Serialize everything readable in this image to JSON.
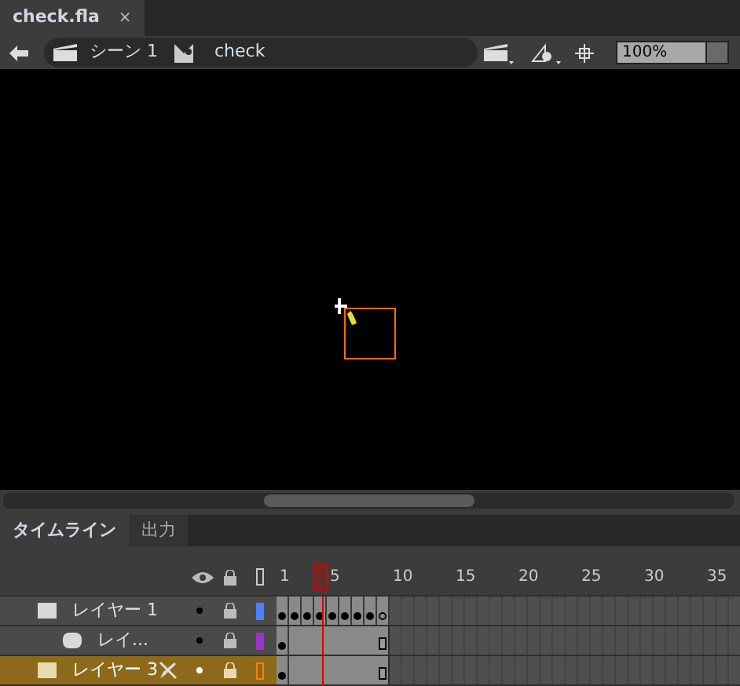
{
  "document_tab": {
    "title": "check.fla",
    "close": "×"
  },
  "edit_bar": {
    "scene": "シーン 1",
    "symbol": "check",
    "zoom": "100%"
  },
  "panel_tabs": [
    {
      "label": "タイムライン",
      "selected": true
    },
    {
      "label": "出力",
      "selected": false
    }
  ],
  "ruler": {
    "labels": [
      "1",
      "5",
      "10",
      "15",
      "20",
      "25",
      "30",
      "35"
    ],
    "playhead": {
      "level": 0.097
    }
  },
  "layers": [
    {
      "name": "レイヤー 1",
      "selected": false,
      "color": "#4f7fff",
      "outline": false,
      "frames": [
        {
          "kind": "key"
        },
        {
          "kind": "key"
        },
        {
          "kind": "key"
        },
        {
          "kind": "key"
        },
        {
          "kind": "key"
        },
        {
          "kind": "key"
        },
        {
          "kind": "key"
        },
        {
          "kind": "key"
        },
        {
          "kind": "empty-key"
        }
      ],
      "children": [
        {
          "name": "レイ...",
          "selected": false,
          "color": "#9933cc",
          "outline": false,
          "frames": [
            {
              "kind": "key"
            },
            {
              "kind": "span"
            },
            {
              "kind": "span"
            },
            {
              "kind": "span"
            },
            {
              "kind": "span"
            },
            {
              "kind": "span"
            },
            {
              "kind": "span"
            },
            {
              "kind": "span"
            },
            {
              "kind": "span-end"
            }
          ]
        }
      ]
    },
    {
      "name": "レイヤー 3",
      "selected": true,
      "color": "#ff8000",
      "outline": true,
      "frames": [
        {
          "kind": "key"
        },
        {
          "kind": "span"
        },
        {
          "kind": "span"
        },
        {
          "kind": "span"
        },
        {
          "kind": "span"
        },
        {
          "kind": "span"
        },
        {
          "kind": "span"
        },
        {
          "kind": "span"
        },
        {
          "kind": "span-end"
        }
      ]
    }
  ]
}
